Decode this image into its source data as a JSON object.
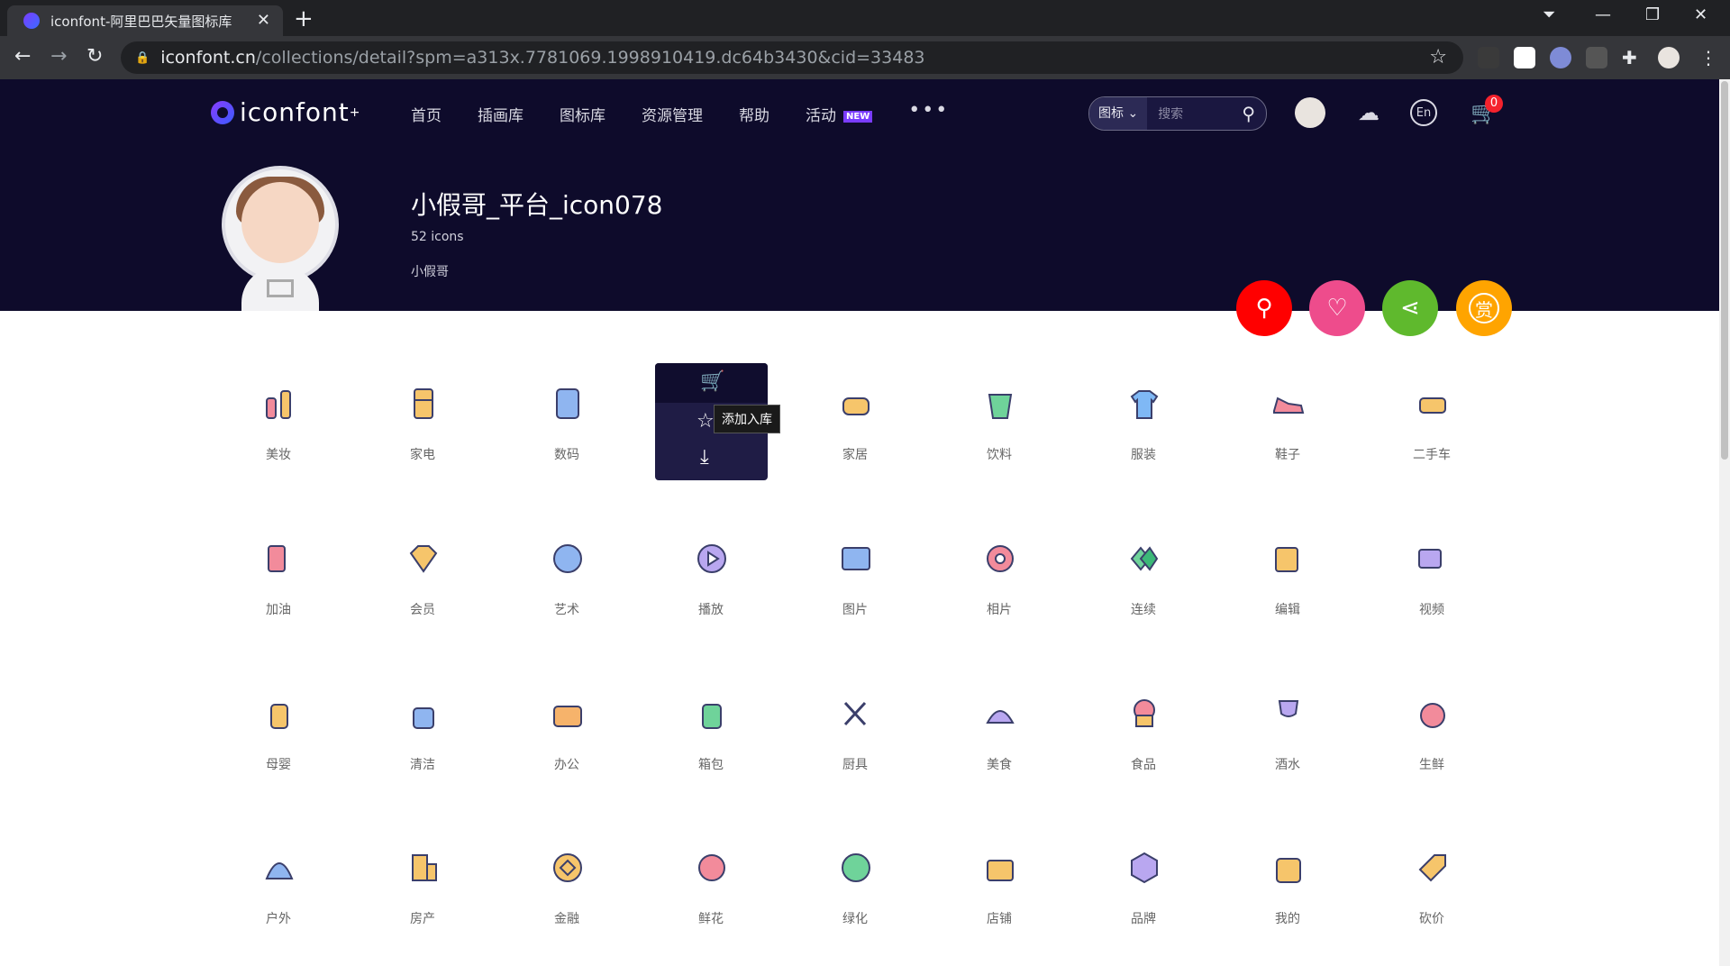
{
  "browser": {
    "tab_title": "iconfont-阿里巴巴矢量图标库",
    "url_host": "iconfont.cn",
    "url_path": "/collections/detail?spm=a313x.7781069.1998910419.dc64b3430&cid=33483"
  },
  "site": {
    "logo_text": "iconfont",
    "nav": [
      "首页",
      "插画库",
      "图标库",
      "资源管理",
      "帮助",
      "活动"
    ],
    "new_badge": "NEW",
    "search_category": "图标",
    "search_placeholder": "搜索",
    "cart_count": "0",
    "lang_label": "En"
  },
  "collection": {
    "title": "小假哥_平台_icon078",
    "count": "52 icons",
    "author": "小假哥"
  },
  "hover": {
    "tooltip": "添加入库"
  },
  "icons": [
    {
      "label": "美妆",
      "icon": "makeup-icon"
    },
    {
      "label": "家电",
      "icon": "fridge-icon"
    },
    {
      "label": "数码",
      "icon": "tablet-icon"
    },
    {
      "label": "",
      "icon": "hidden-under-hover"
    },
    {
      "label": "家居",
      "icon": "sofa-icon"
    },
    {
      "label": "饮料",
      "icon": "drink-icon"
    },
    {
      "label": "服装",
      "icon": "tshirt-icon"
    },
    {
      "label": "鞋子",
      "icon": "shoe-icon"
    },
    {
      "label": "二手车",
      "icon": "car-icon"
    },
    {
      "label": "加油",
      "icon": "fuel-icon"
    },
    {
      "label": "会员",
      "icon": "diamond-icon"
    },
    {
      "label": "艺术",
      "icon": "palette-icon"
    },
    {
      "label": "播放",
      "icon": "play-icon"
    },
    {
      "label": "图片",
      "icon": "image-icon"
    },
    {
      "label": "相片",
      "icon": "flower-photo-icon"
    },
    {
      "label": "连续",
      "icon": "continuous-icon"
    },
    {
      "label": "编辑",
      "icon": "edit-icon"
    },
    {
      "label": "视频",
      "icon": "video-icon"
    },
    {
      "label": "母婴",
      "icon": "baby-bottle-icon"
    },
    {
      "label": "清洁",
      "icon": "cleaning-icon"
    },
    {
      "label": "办公",
      "icon": "briefcase-icon"
    },
    {
      "label": "箱包",
      "icon": "luggage-icon"
    },
    {
      "label": "厨具",
      "icon": "kitchen-tools-icon"
    },
    {
      "label": "美食",
      "icon": "food-cloche-icon"
    },
    {
      "label": "食品",
      "icon": "cupcake-icon"
    },
    {
      "label": "酒水",
      "icon": "wine-icon"
    },
    {
      "label": "生鲜",
      "icon": "peach-icon"
    },
    {
      "label": "户外",
      "icon": "tent-icon"
    },
    {
      "label": "房产",
      "icon": "building-icon"
    },
    {
      "label": "金融",
      "icon": "coin-icon"
    },
    {
      "label": "鲜花",
      "icon": "tulip-icon"
    },
    {
      "label": "绿化",
      "icon": "sprout-icon"
    },
    {
      "label": "店铺",
      "icon": "store-icon"
    },
    {
      "label": "品牌",
      "icon": "brand-r-icon"
    },
    {
      "label": "我的",
      "icon": "group-buy-icon"
    },
    {
      "label": "砍价",
      "icon": "price-tag-icon"
    }
  ],
  "colors": {
    "header_bg": "#0e0b2b",
    "search_action": "#ff0000",
    "favorite_action": "#ee4c8c",
    "share_action": "#5fb92d",
    "reward_action": "#ffa400"
  }
}
